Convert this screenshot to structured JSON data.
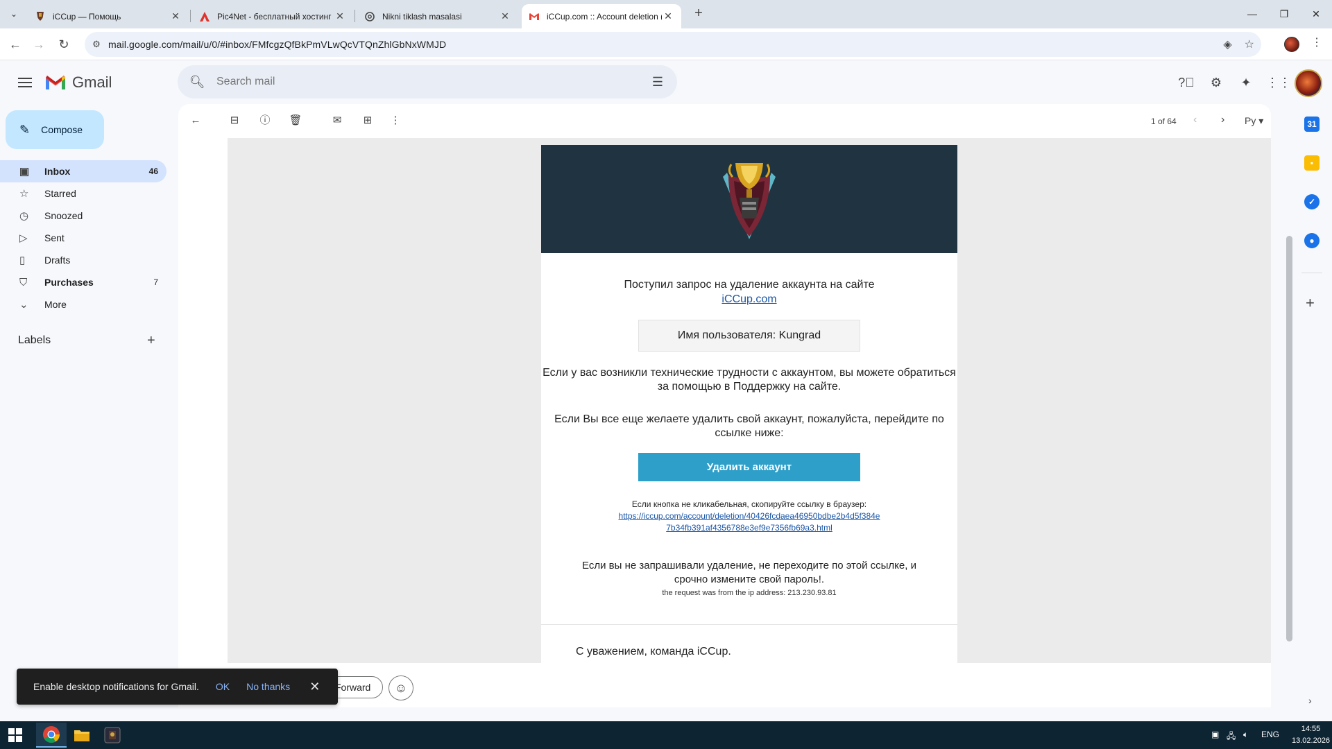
{
  "browser": {
    "tabs": [
      {
        "title": "iCCup — Помощь",
        "icon": "iccup-icon"
      },
      {
        "title": "Pic4Net - бесплатный хостинг",
        "icon": "pic4net-icon"
      },
      {
        "title": "Nikni tiklash masalasi",
        "icon": "chatgpt-icon"
      },
      {
        "title": "iCCup.com :: Account deletion (",
        "icon": "gmail-icon"
      }
    ],
    "url": "mail.google.com/mail/u/0/#inbox/FMfcgzQfBkPmVLwQcVTQnZhlGbNxWMJD"
  },
  "gmail": {
    "logo_text": "Gmail",
    "search_placeholder": "Search mail",
    "compose_label": "Compose",
    "nav": [
      {
        "label": "Inbox",
        "count": "46",
        "icon": "inbox-icon"
      },
      {
        "label": "Starred",
        "count": "",
        "icon": "star-icon"
      },
      {
        "label": "Snoozed",
        "count": "",
        "icon": "clock-icon"
      },
      {
        "label": "Sent",
        "count": "",
        "icon": "send-icon"
      },
      {
        "label": "Drafts",
        "count": "",
        "icon": "draft-icon"
      },
      {
        "label": "Purchases",
        "count": "7",
        "icon": "bag-icon"
      },
      {
        "label": "More",
        "count": "",
        "icon": "chevron-down-icon"
      }
    ],
    "labels_title": "Labels",
    "pager": "1 of 64",
    "language": "Ру"
  },
  "email": {
    "line1": "Поступил запрос на удаление аккаунта на сайте",
    "site_link": "iCCup.com",
    "username_label": "Имя пользователя: Kungrad",
    "para1": "Если у вас возникли технические трудности с аккаунтом, вы можете обратиться за помощью в Поддержку на сайте.",
    "para2": "Если Вы все еще желаете удалить свой аккаунт, пожалуйста, перейдите по ссылке ниже:",
    "button": "Удалить аккаунт",
    "copy_hint": "Если кнопка не кликабельная, скопируйте ссылку в браузер:",
    "link_part1": "https://iccup.com/account/deletion/40426fcdaea46950bdbe2b4d5f384e",
    "link_part2": "7b34fb391af4356788e3ef9e7356fb69a3.html",
    "warning": "Если вы не запрашивали удаление, не переходите по этой ссылке, и срочно измените свой пароль!.",
    "ip_note": "the request was from the ip address: 213.230.93.81",
    "signature": "С уважением, команда iCCup."
  },
  "reply": {
    "forward_label": "Forward"
  },
  "snackbar": {
    "message": "Enable desktop notifications for Gmail.",
    "ok": "OK",
    "no_thanks": "No thanks"
  },
  "taskbar": {
    "lang": "ENG",
    "time": "14:55",
    "date": "13.02.2026"
  },
  "colors": {
    "email_header_bg": "#1f3440",
    "delete_button": "#2e9fc9",
    "compose_bg": "#c2e7ff",
    "inbox_active": "#d3e3fd"
  }
}
